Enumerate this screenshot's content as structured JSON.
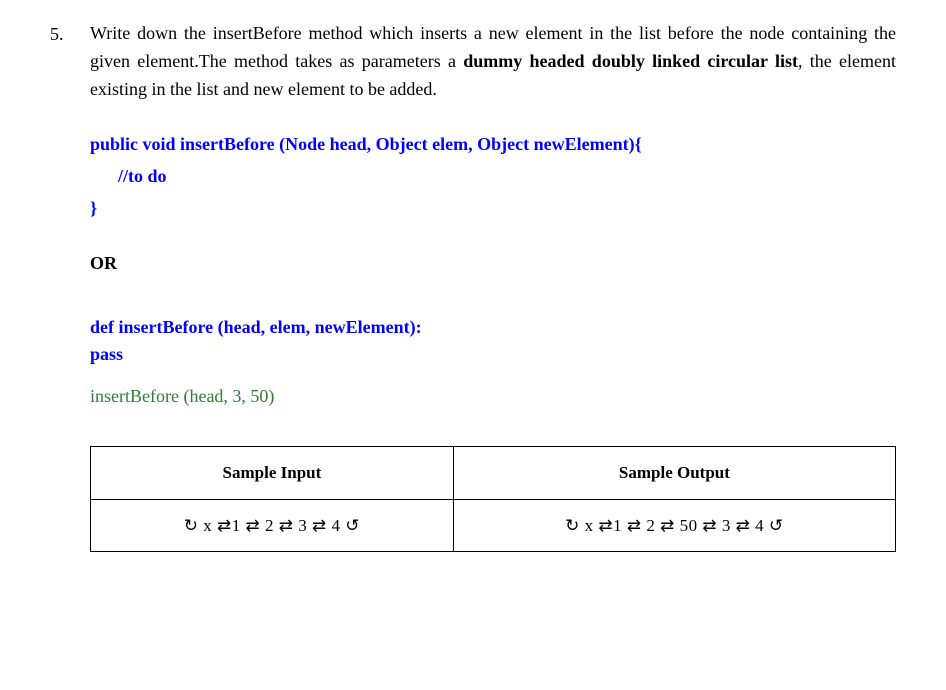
{
  "question": {
    "number": "5.",
    "text_pre": "Write down the insertBefore method which inserts a new element in the list before the node containing the given element.The method takes as parameters a ",
    "bold_phrase": "dummy headed doubly linked circular list",
    "text_post": ", the element existing in the list and new element to be added."
  },
  "java_signature": "public void insertBefore (Node head, Object elem, Object newElement){",
  "java_comment": "//to do",
  "java_close": "}",
  "or_label": "OR",
  "py_def": "def insertBefore (head, elem, newElement):",
  "py_pass": "pass",
  "call_example": "insertBefore (head, 3, 50)",
  "table": {
    "header_input": "Sample Input",
    "header_output": "Sample Output",
    "row_input": "↻ x ⇄1 ⇄ 2 ⇄ 3 ⇄ 4 ↺",
    "row_output": "↻ x ⇄1 ⇄ 2 ⇄ 50 ⇄ 3 ⇄ 4 ↺"
  }
}
